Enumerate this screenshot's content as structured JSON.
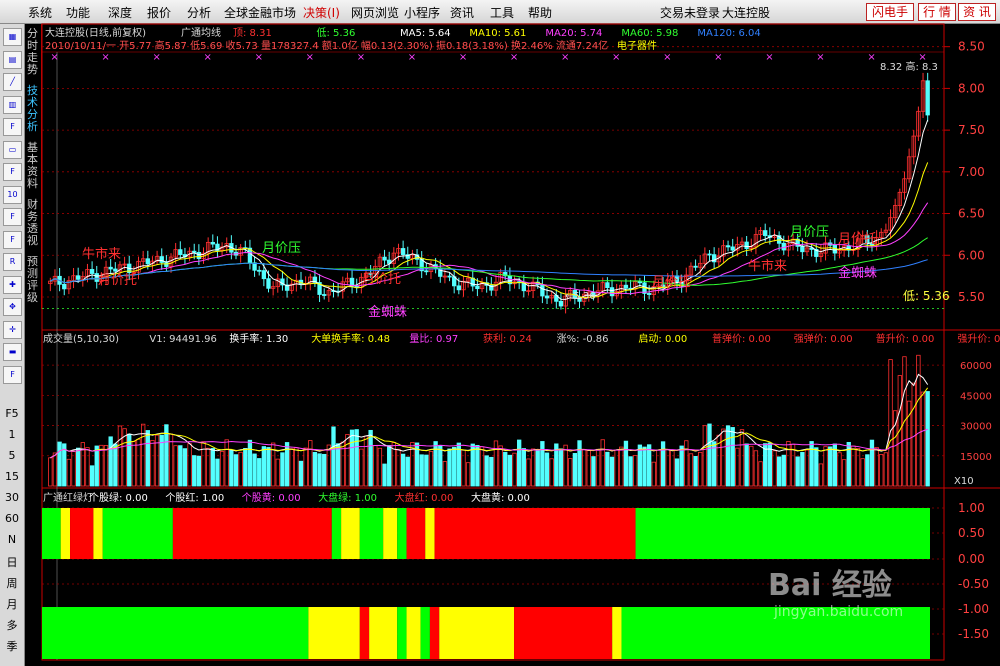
{
  "menu": {
    "items": [
      "系统",
      "功能",
      "深度",
      "报价",
      "分析",
      "全球金融市场",
      "决策(I)",
      "网页浏览",
      "小程序",
      "资讯",
      "工具",
      "帮助"
    ],
    "red_index": 6,
    "status": "交易未登录",
    "stock_title": "大连控股",
    "btn_flash": "闪电手",
    "btn_quote": "行 情",
    "btn_info": "资 讯"
  },
  "toolbar": {
    "icons": [
      "calc-icon",
      "grid-icon",
      "line-icon",
      "bar-icon",
      "fi-icon",
      "minute-icon",
      "fe-icon",
      "f10-icon",
      "fz-icon",
      "fx-icon",
      "rsi-icon",
      "tool-icon",
      "move-icon",
      "cross-icon",
      "ruler-icon",
      "f-icon"
    ],
    "labels": [
      "F5",
      "1",
      "5",
      "15",
      "30",
      "60",
      "N",
      "日",
      "周",
      "月",
      "多",
      "季"
    ]
  },
  "side_tabs": [
    "分时走势",
    "技术分析",
    "基本资料",
    "财务透视",
    "预测评级"
  ],
  "side_active": 1,
  "header": {
    "line1": [
      {
        "text": "大连控股(日线,前复权)",
        "color": "#d8d8d8"
      },
      {
        "text": "广通均线",
        "color": "#d8d8d8"
      },
      {
        "text": "顶: 8.31",
        "color": "#ff3030"
      },
      {
        "text": "低: 5.36",
        "color": "#30ff30"
      },
      {
        "text": "MA5: 5.64",
        "color": "#ffffff"
      },
      {
        "text": "MA10: 5.61",
        "color": "#ffff00"
      },
      {
        "text": "MA20: 5.74",
        "color": "#ff40ff"
      },
      {
        "text": "MA60: 5.98",
        "color": "#30ff30"
      },
      {
        "text": "MA120: 6.04",
        "color": "#3080ff"
      }
    ],
    "line2": "2010/10/11/一 开5.77 高5.87 低5.69 收5.73 量178327.4 额1.0亿 幅0.13(2.30%) 振0.18(3.18%) 换2.46% 流通7.24亿",
    "sector": "电子器件"
  },
  "chart_data": {
    "type": "candlestick",
    "price_axis": {
      "ticks": [
        8.5,
        8.0,
        7.5,
        7.0,
        6.5,
        6.0,
        5.5
      ],
      "range": [
        5.2,
        8.7
      ]
    },
    "high": 8.32,
    "low": 5.36,
    "low_marker": 5.36,
    "price_annotations": [
      {
        "text": "牛市来",
        "color": "#ff3030"
      },
      {
        "text": "月价托",
        "color": "#ff3030"
      },
      {
        "text": "月价压",
        "color": "#30ff30"
      },
      {
        "text": "月价托",
        "color": "#ff3030"
      },
      {
        "text": "金蜘蛛",
        "color": "#ff40ff"
      },
      {
        "text": "月价托",
        "color": "#ff3030"
      },
      {
        "text": "牛市来",
        "color": "#ff3030"
      },
      {
        "text": "月价压",
        "color": "#30ff30"
      },
      {
        "text": "月价托",
        "color": "#ff3030"
      },
      {
        "text": "金蜘蛛",
        "color": "#ff40ff"
      }
    ],
    "high_label": "8.32 高: 8.3",
    "low_label": "低: 5.36",
    "volume_header": [
      {
        "text": "成交量(5,10,30)",
        "color": "#d8d8d8"
      },
      {
        "text": "V1: 94491.96",
        "color": "#d8d8d8"
      },
      {
        "text": "换手率: 1.30",
        "color": "#ffffff"
      },
      {
        "text": "大单换手率: 0.48",
        "color": "#ffff00"
      },
      {
        "text": "量比: 0.97",
        "color": "#ff40ff"
      },
      {
        "text": "获利: 0.24",
        "color": "#ff3030"
      },
      {
        "text": "涨%: -0.86",
        "color": "#d8d8d8"
      },
      {
        "text": "启动: 0.00",
        "color": "#ffff00"
      },
      {
        "text": "普弹价: 0.00",
        "color": "#ff3030"
      },
      {
        "text": "强弹价: 0.00",
        "color": "#ff3030"
      },
      {
        "text": "普升价: 0.00",
        "color": "#ff3030"
      },
      {
        "text": "强升价: 0.00",
        "color": "#ff3030"
      }
    ],
    "volume_axis": {
      "ticks": [
        60000,
        45000,
        30000,
        15000
      ],
      "multiplier": "X10"
    },
    "light_header": [
      {
        "text": "广通红绿灯",
        "color": "#d8d8d8"
      },
      {
        "text": "个股绿: 0.00",
        "color": "#ffffff"
      },
      {
        "text": "个股红: 1.00",
        "color": "#ffffff"
      },
      {
        "text": "个股黄: 0.00",
        "color": "#ff40ff"
      },
      {
        "text": "大盘绿: 1.00",
        "color": "#30ff30"
      },
      {
        "text": "大盘红: 0.00",
        "color": "#ff3030"
      },
      {
        "text": "大盘黄: 0.00",
        "color": "#ffffff"
      }
    ],
    "light_axis": {
      "ticks": [
        "1.00",
        "0.50",
        "0.00",
        "-0.50",
        "-1.00",
        "-1.50"
      ]
    },
    "light_top": [
      [
        "G",
        0,
        4
      ],
      [
        "Y",
        4,
        2
      ],
      [
        "R",
        6,
        5
      ],
      [
        "Y",
        11,
        2
      ],
      [
        "G",
        13,
        15
      ],
      [
        "R",
        28,
        34
      ],
      [
        "G",
        62,
        2
      ],
      [
        "Y",
        64,
        4
      ],
      [
        "G",
        68,
        5
      ],
      [
        "Y",
        73,
        3
      ],
      [
        "G",
        76,
        2
      ],
      [
        "R",
        78,
        4
      ],
      [
        "Y",
        82,
        2
      ],
      [
        "R",
        84,
        43
      ],
      [
        "G",
        127,
        63
      ]
    ],
    "light_bottom": [
      [
        "G",
        0,
        57
      ],
      [
        "Y",
        57,
        11
      ],
      [
        "R",
        68,
        2
      ],
      [
        "Y",
        70,
        6
      ],
      [
        "G",
        76,
        2
      ],
      [
        "Y",
        78,
        3
      ],
      [
        "G",
        81,
        2
      ],
      [
        "R",
        83,
        2
      ],
      [
        "Y",
        85,
        16
      ],
      [
        "R",
        101,
        21
      ],
      [
        "Y",
        122,
        2
      ],
      [
        "G",
        124,
        66
      ]
    ],
    "colors": {
      "up": "#ff3030",
      "down": "#54ffff",
      "grid": "#9a0000",
      "axis": "#cc0000",
      "green": "#00ff00",
      "red": "#ff0000",
      "yellow": "#ffff00"
    }
  },
  "watermark": {
    "text": "Bai 经验",
    "url": "jingyan.baidu.com"
  }
}
